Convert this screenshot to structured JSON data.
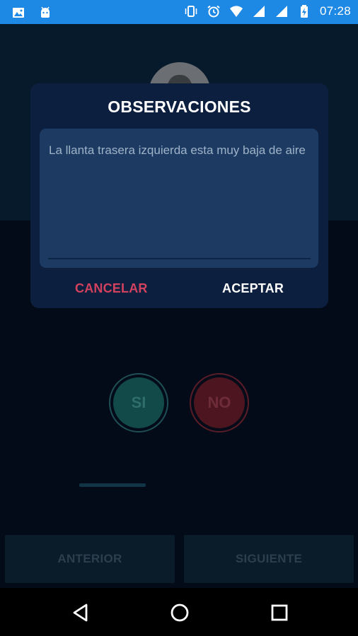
{
  "status_bar": {
    "time": "07:28",
    "left_icons": [
      "image-icon",
      "android-icon"
    ],
    "right_icons": [
      "vibrate-icon",
      "alarm-icon",
      "wifi-icon",
      "signal-icon",
      "signal-icon",
      "battery-charging-icon"
    ]
  },
  "dialog": {
    "title": "OBSERVACIONES",
    "observation_text": "La llanta trasera izquierda esta muy baja de aire",
    "cancel_label": "CANCELAR",
    "accept_label": "ACEPTAR"
  },
  "question": {
    "yes_label": "SI",
    "no_label": "NO"
  },
  "navigation": {
    "previous_label": "ANTERIOR",
    "next_label": "SIGUIENTE"
  },
  "system_nav": {
    "icons": [
      "back-icon",
      "home-icon",
      "recents-icon"
    ]
  },
  "colors": {
    "status_bar": "#1e88e5",
    "dialog_bg": "#0c1f3f",
    "field_bg": "#1c3a62",
    "cancel": "#d2415e",
    "accept": "#ffffff",
    "yes": "#124a49",
    "no": "#4c1520"
  }
}
